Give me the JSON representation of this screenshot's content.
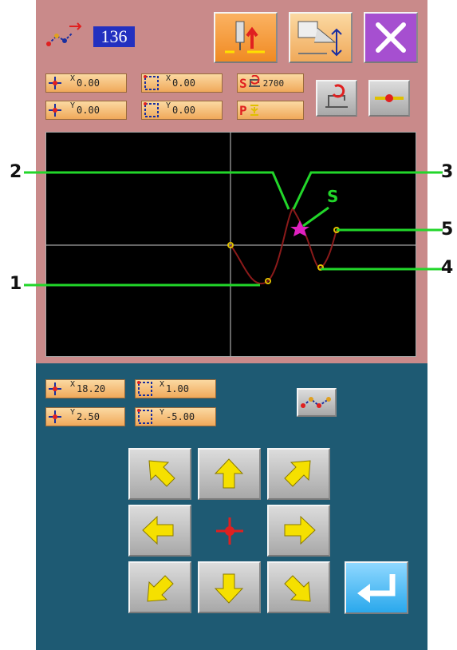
{
  "header": {
    "stitch_count": "136"
  },
  "coords": {
    "top_x_label": "X",
    "top_x_value": "0.00",
    "top_y_label": "Y",
    "top_y_value": "0.00",
    "size_x_label": "X",
    "size_x_value": "0.00",
    "size_y_label": "Y",
    "size_y_value": "0.00",
    "speed_label": "S",
    "speed_value": "2700",
    "p_label": "P"
  },
  "bottom": {
    "move_x_label": "X",
    "move_x_value": "18.20",
    "move_y_label": "Y",
    "move_y_value": "2.50",
    "scale_x_label": "X",
    "scale_x_value": "1.00",
    "scale_y_label": "Y",
    "scale_y_value": "-5.00"
  },
  "callouts": {
    "c1": "1",
    "c2": "2",
    "c3": "3",
    "c4": "4",
    "c5": "5",
    "s": "S"
  },
  "icons": {
    "stitch": "stitch-pattern-icon",
    "needle_up": "needle-up-icon",
    "presser_foot": "presser-foot-icon",
    "close": "close-icon",
    "enter": "enter-icon"
  },
  "colors": {
    "top_panel": "#c98a8a",
    "bottom_panel": "#1e5a73",
    "close_button": "#a64fd0",
    "callout_line": "#22d62a",
    "pattern_line": "#8b1a1a",
    "arrow_fill": "#f5e000"
  }
}
